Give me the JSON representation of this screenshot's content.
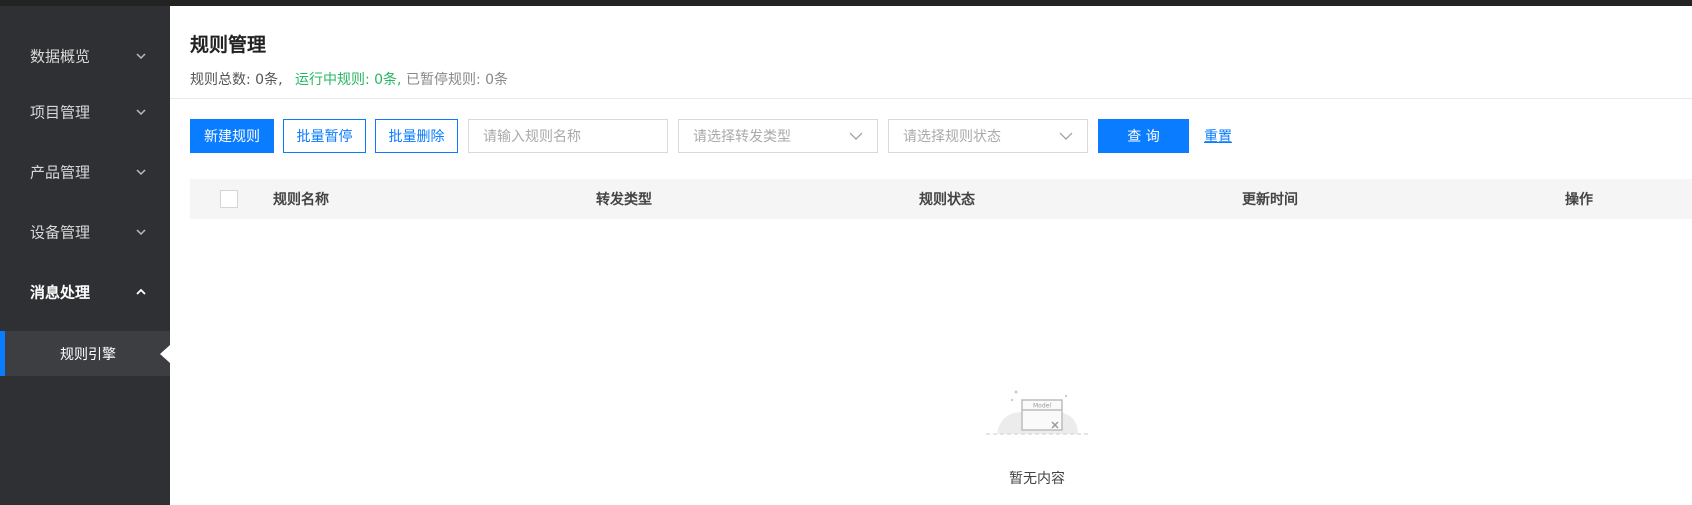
{
  "sidebar": {
    "items": [
      {
        "label": "数据概览",
        "expanded": false
      },
      {
        "label": "项目管理",
        "expanded": false
      },
      {
        "label": "产品管理",
        "expanded": false
      },
      {
        "label": "设备管理",
        "expanded": false
      },
      {
        "label": "消息处理",
        "expanded": true
      }
    ],
    "sub_item": {
      "label": "规则引擎"
    }
  },
  "header": {
    "title": "规则管理",
    "summary": {
      "total": "规则总数: 0条,",
      "running": "运行中规则: 0条,",
      "paused": "已暂停规则: 0条"
    }
  },
  "toolbar": {
    "new_rule": "新建规则",
    "batch_pause": "批量暂停",
    "batch_delete": "批量删除",
    "rule_name_placeholder": "请输入规则名称",
    "forward_type_placeholder": "请选择转发类型",
    "rule_status_placeholder": "请选择规则状态",
    "query": "查 询",
    "reset": "重置"
  },
  "table": {
    "columns": [
      "规则名称",
      "转发类型",
      "规则状态",
      "更新时间",
      "操作"
    ]
  },
  "empty": {
    "icon_label": "Model",
    "text": "暂无内容"
  },
  "colors": {
    "primary": "#0a7cff",
    "running": "#28b761",
    "sidebar_bg": "#2f3033"
  }
}
